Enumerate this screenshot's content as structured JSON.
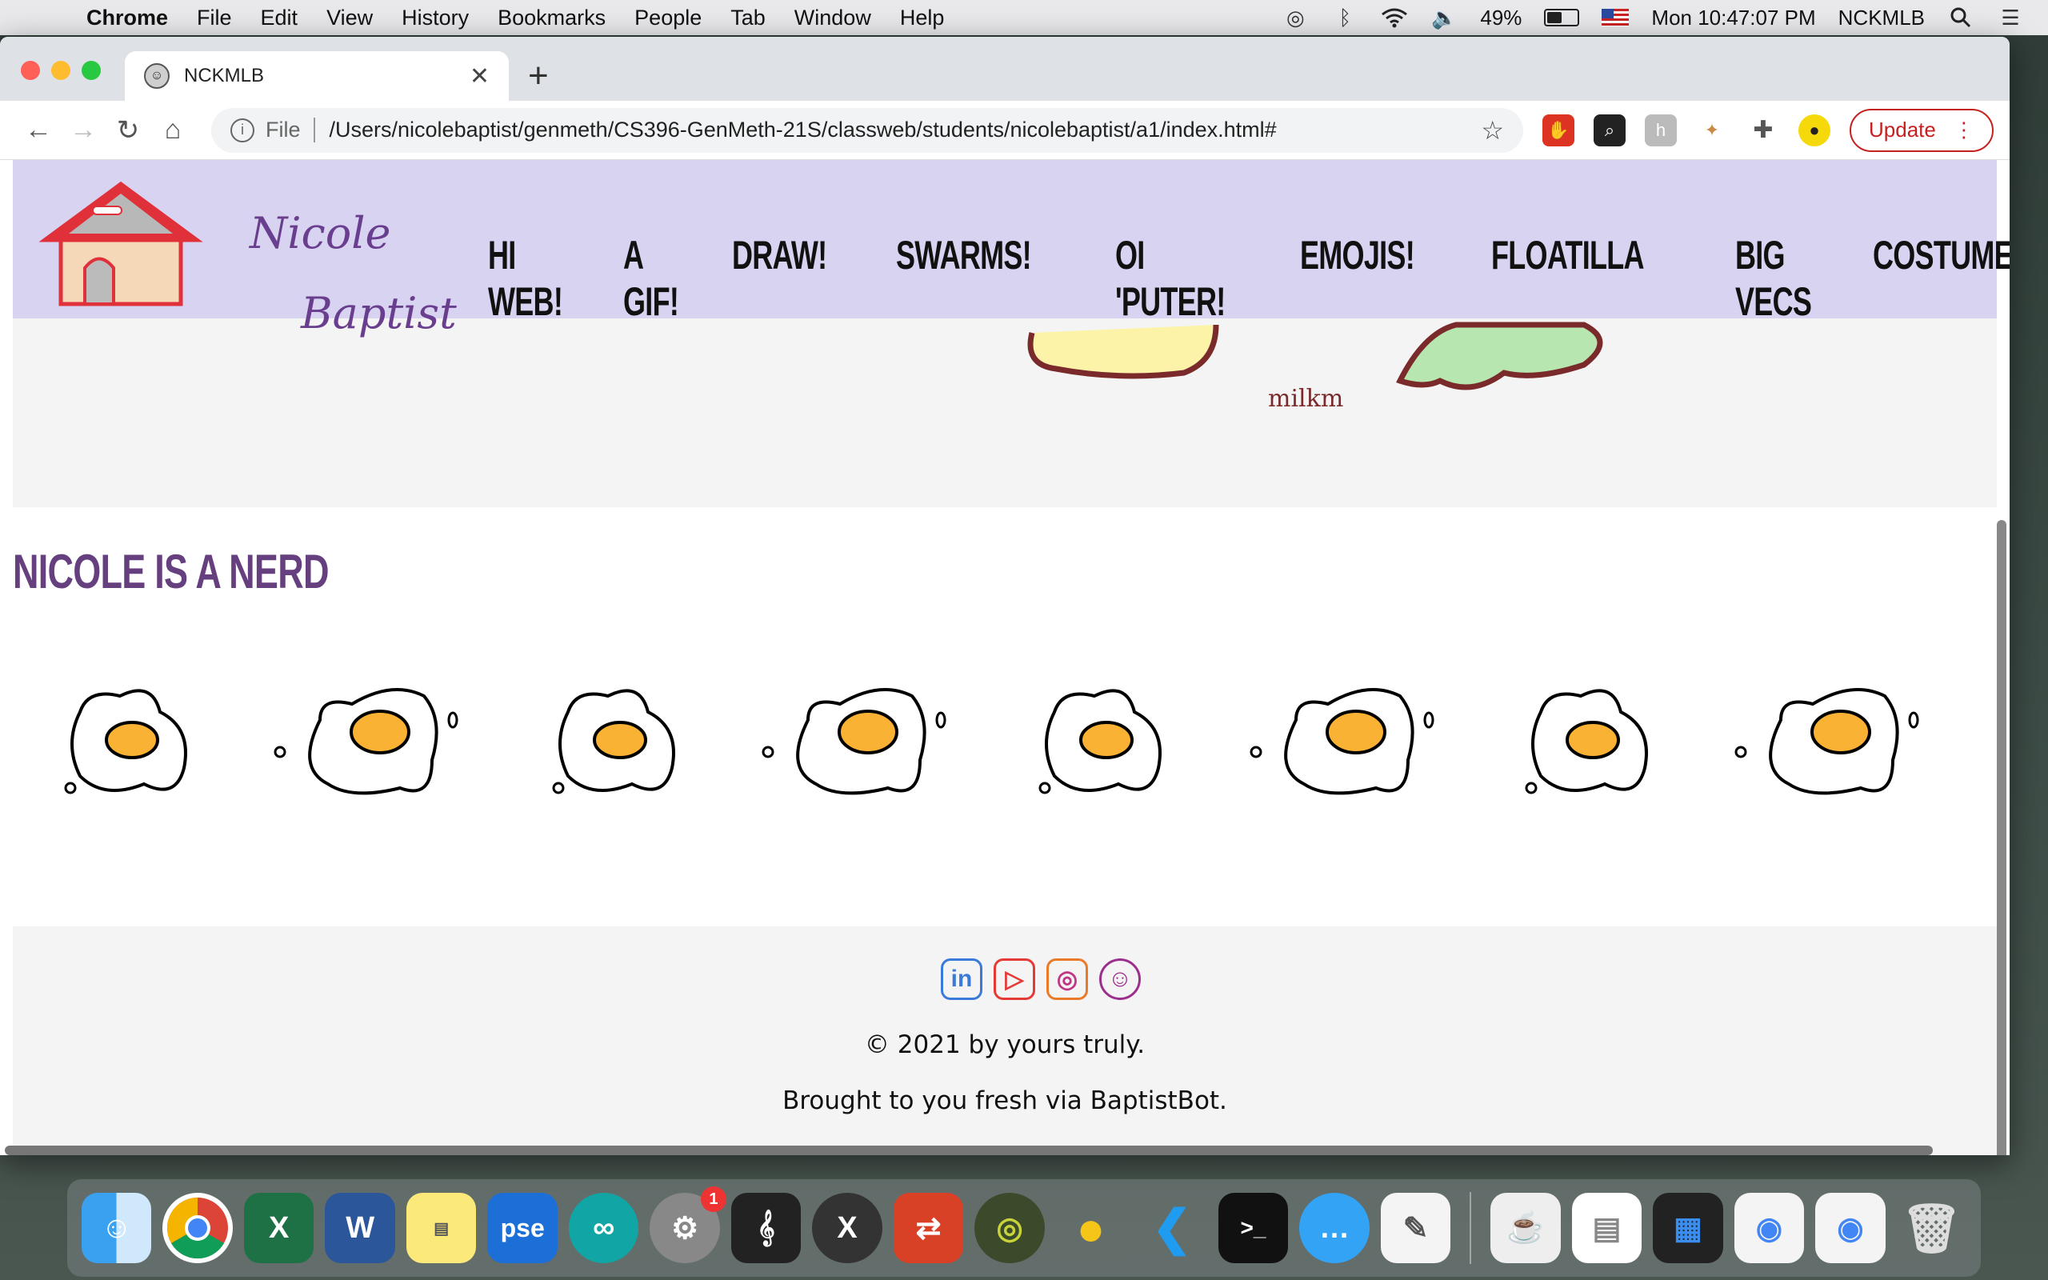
{
  "menubar": {
    "app_name": "Chrome",
    "items": [
      "File",
      "Edit",
      "View",
      "History",
      "Bookmarks",
      "People",
      "Tab",
      "Window",
      "Help"
    ],
    "battery": "49%",
    "clock": "Mon 10:47:07 PM",
    "user": "NCKMLB"
  },
  "browser": {
    "tab_title": "NCKMLB",
    "url_scheme": "File",
    "url": "/Users/nicolebaptist/genmeth/CS396-GenMeth-21S/classweb/students/nicolebaptist/a1/index.html#",
    "update_label": "Update"
  },
  "site": {
    "brand_first": "Nicole",
    "brand_last": "Baptist",
    "nav": [
      "HI WEB!",
      "A GIF!",
      "DRAW!",
      "SWARMS!",
      "OI 'PUTER!",
      "EMOJIS!",
      "FLOATILLA",
      "BIG VECS",
      "COSTUMES!"
    ],
    "partial_art_label": "milkm",
    "section_title": "NICOLE IS A NERD",
    "footer": {
      "copyright": "© 2021 by yours truly.",
      "tagline": "Brought to you fresh via BaptistBot."
    }
  },
  "colors": {
    "header_bg": "#d8d3f0",
    "brand_purple": "#663f7f",
    "yolk": "#f9b233",
    "update_red": "#c5221f"
  },
  "dock": {
    "icons": [
      "finder-icon",
      "chrome-icon",
      "excel-icon",
      "word-icon",
      "stickies-icon",
      "pse-icon",
      "arduino-icon",
      "system-preferences-icon",
      "piano-icon",
      "x11-icon",
      "remote-desktop-icon",
      "radar-icon",
      "cyberduck-icon",
      "vscode-icon",
      "terminal-icon",
      "messages-icon",
      "textedit-icon",
      "jar-icon",
      "document-icon",
      "screen-icon",
      "chrome-window-icon",
      "chrome-window-icon-2",
      "trash-icon"
    ],
    "prefs_badge": "1"
  }
}
